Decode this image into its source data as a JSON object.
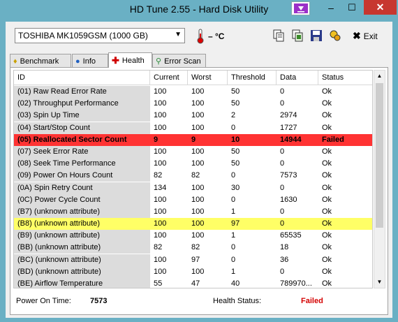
{
  "window": {
    "title": "HD Tune 2.55 - Hard Disk Utility",
    "minimize": "–",
    "maximize": "☐",
    "close": "✕"
  },
  "toolbar": {
    "drive": "TOSHIBA MK1059GSM (1000 GB)",
    "temperature": "– °C",
    "exit_label": "Exit"
  },
  "tabs": [
    {
      "label": "Benchmark",
      "icon": "pin-icon"
    },
    {
      "label": "Info",
      "icon": "info-icon"
    },
    {
      "label": "Health",
      "icon": "red-cross-icon"
    },
    {
      "label": "Error Scan",
      "icon": "magnifier-icon"
    }
  ],
  "table": {
    "columns": [
      "ID",
      "Current",
      "Worst",
      "Threshold",
      "Data",
      "Status"
    ],
    "rows": [
      {
        "id": "(01) Raw Read Error Rate",
        "current": "100",
        "worst": "100",
        "threshold": "50",
        "data": "0",
        "status": "Ok",
        "state": "normal"
      },
      {
        "id": "(02) Throughput Performance",
        "current": "100",
        "worst": "100",
        "threshold": "50",
        "data": "0",
        "status": "Ok",
        "state": "normal"
      },
      {
        "id": "(03) Spin Up Time",
        "current": "100",
        "worst": "100",
        "threshold": "2",
        "data": "2974",
        "status": "Ok",
        "state": "normal"
      },
      {
        "id": "(04) Start/Stop Count",
        "current": "100",
        "worst": "100",
        "threshold": "0",
        "data": "1727",
        "status": "Ok",
        "state": "normal"
      },
      {
        "id": "(05) Reallocated Sector Count",
        "current": "9",
        "worst": "9",
        "threshold": "10",
        "data": "14944",
        "status": "Failed",
        "state": "failed"
      },
      {
        "id": "(07) Seek Error Rate",
        "current": "100",
        "worst": "100",
        "threshold": "50",
        "data": "0",
        "status": "Ok",
        "state": "normal"
      },
      {
        "id": "(08) Seek Time Performance",
        "current": "100",
        "worst": "100",
        "threshold": "50",
        "data": "0",
        "status": "Ok",
        "state": "normal"
      },
      {
        "id": "(09) Power On Hours Count",
        "current": "82",
        "worst": "82",
        "threshold": "0",
        "data": "7573",
        "status": "Ok",
        "state": "normal"
      },
      {
        "id": "(0A) Spin Retry Count",
        "current": "134",
        "worst": "100",
        "threshold": "30",
        "data": "0",
        "status": "Ok",
        "state": "normal"
      },
      {
        "id": "(0C) Power Cycle Count",
        "current": "100",
        "worst": "100",
        "threshold": "0",
        "data": "1630",
        "status": "Ok",
        "state": "normal"
      },
      {
        "id": "(B7) (unknown attribute)",
        "current": "100",
        "worst": "100",
        "threshold": "1",
        "data": "0",
        "status": "Ok",
        "state": "normal"
      },
      {
        "id": "(B8) (unknown attribute)",
        "current": "100",
        "worst": "100",
        "threshold": "97",
        "data": "0",
        "status": "Ok",
        "state": "warn"
      },
      {
        "id": "(B9) (unknown attribute)",
        "current": "100",
        "worst": "100",
        "threshold": "1",
        "data": "65535",
        "status": "Ok",
        "state": "normal"
      },
      {
        "id": "(BB) (unknown attribute)",
        "current": "82",
        "worst": "82",
        "threshold": "0",
        "data": "18",
        "status": "Ok",
        "state": "normal"
      },
      {
        "id": "(BC) (unknown attribute)",
        "current": "100",
        "worst": "97",
        "threshold": "0",
        "data": "36",
        "status": "Ok",
        "state": "normal"
      },
      {
        "id": "(BD) (unknown attribute)",
        "current": "100",
        "worst": "100",
        "threshold": "1",
        "data": "0",
        "status": "Ok",
        "state": "normal"
      },
      {
        "id": "(BE) Airflow Temperature",
        "current": "55",
        "worst": "47",
        "threshold": "40",
        "data": "789970...",
        "status": "Ok",
        "state": "normal"
      }
    ]
  },
  "footer": {
    "power_on_label": "Power On Time:",
    "power_on_value": "7573",
    "health_label": "Health Status:",
    "health_value": "Failed"
  },
  "colors": {
    "failed_row": "#ff3333",
    "warn_row": "#ffff66",
    "failed_text": "#d40000",
    "titlebar": "#6ab0c4"
  }
}
